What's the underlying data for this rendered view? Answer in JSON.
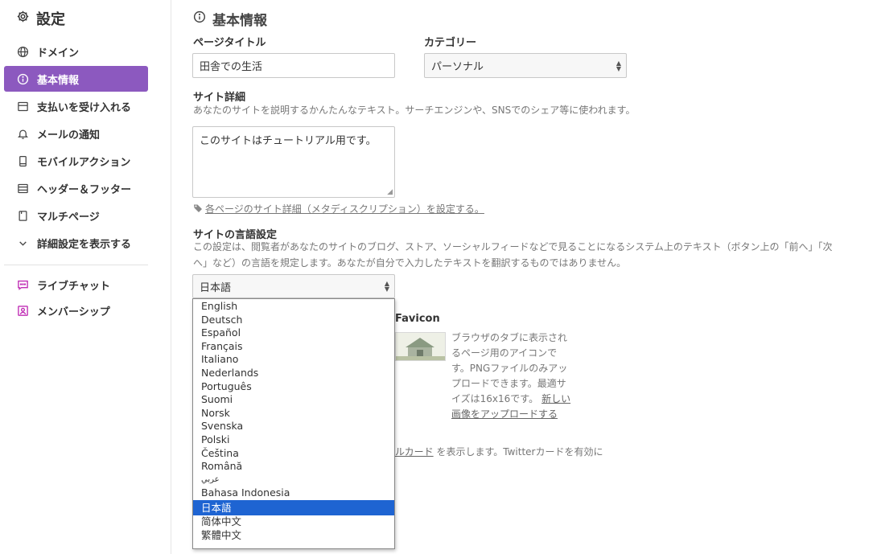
{
  "sidebar": {
    "title": "設定",
    "items": [
      {
        "label": "ドメイン",
        "icon": "globe-icon"
      },
      {
        "label": "基本情報",
        "icon": "info-icon",
        "active": true
      },
      {
        "label": "支払いを受け入れる",
        "icon": "credit-card-icon"
      },
      {
        "label": "メールの通知",
        "icon": "bell-icon"
      },
      {
        "label": "モバイルアクション",
        "icon": "mobile-icon"
      },
      {
        "label": "ヘッダー＆フッター",
        "icon": "header-footer-icon"
      },
      {
        "label": "マルチページ",
        "icon": "pages-icon"
      },
      {
        "label": "詳細設定を表示する",
        "icon": "chevron-down-icon"
      }
    ],
    "apps": [
      {
        "label": "ライブチャット",
        "icon": "chat-icon"
      },
      {
        "label": "メンバーシップ",
        "icon": "member-icon"
      }
    ]
  },
  "main": {
    "heading": "基本情報",
    "page_title_label": "ページタイトル",
    "page_title_value": "田舎での生活",
    "category_label": "カテゴリー",
    "category_value": "パーソナル",
    "site_detail_label": "サイト詳細",
    "site_detail_desc": "あなたのサイトを説明するかんたんなテキスト。サーチエンジンや、SNSでのシェア等に使われます。",
    "site_detail_value": "このサイトはチュートリアル用です。",
    "meta_link": "各ページのサイト詳細（メタディスクリプション）を設定する。",
    "language_label": "サイトの言語設定",
    "language_desc_1": "この設定は、閲覧者があなたのサイトのブログ、ストア、ソーシャルフィードなどで見ることになるシステム上のテキスト（ボタン上の「前へ」「次",
    "language_desc_2": "へ」など）の言語を規定します。あなたが自分で入力したテキストを翻訳するものではありません。",
    "language_value": "日本語",
    "language_options": [
      "English",
      "Deutsch",
      "Español",
      "Français",
      "Italiano",
      "Nederlands",
      "Português",
      "Suomi",
      "Norsk",
      "Svenska",
      "Polski",
      "Čeština",
      "Română",
      "عربي",
      "Bahasa Indonesia",
      "日本語",
      "简体中文",
      "繁體中文"
    ],
    "language_selected_index": 15,
    "favicon_label": "Favicon",
    "favicon_desc": [
      "ブラウザのタブに表示され",
      "るページ用のアイコンで",
      "す。PNGファイルのみアッ",
      "プロードできます。最適サ",
      "イズは16x16です。"
    ],
    "favicon_link_1": "新しい",
    "favicon_link_2": "画像をアップロードする",
    "twitter_link": "ルカード",
    "twitter_text": " を表示します。Twitterカードを有効に"
  },
  "colors": {
    "accent": "#8c59bf",
    "selected_option": "#1e64d2",
    "app_icon": "#c02fb5"
  }
}
